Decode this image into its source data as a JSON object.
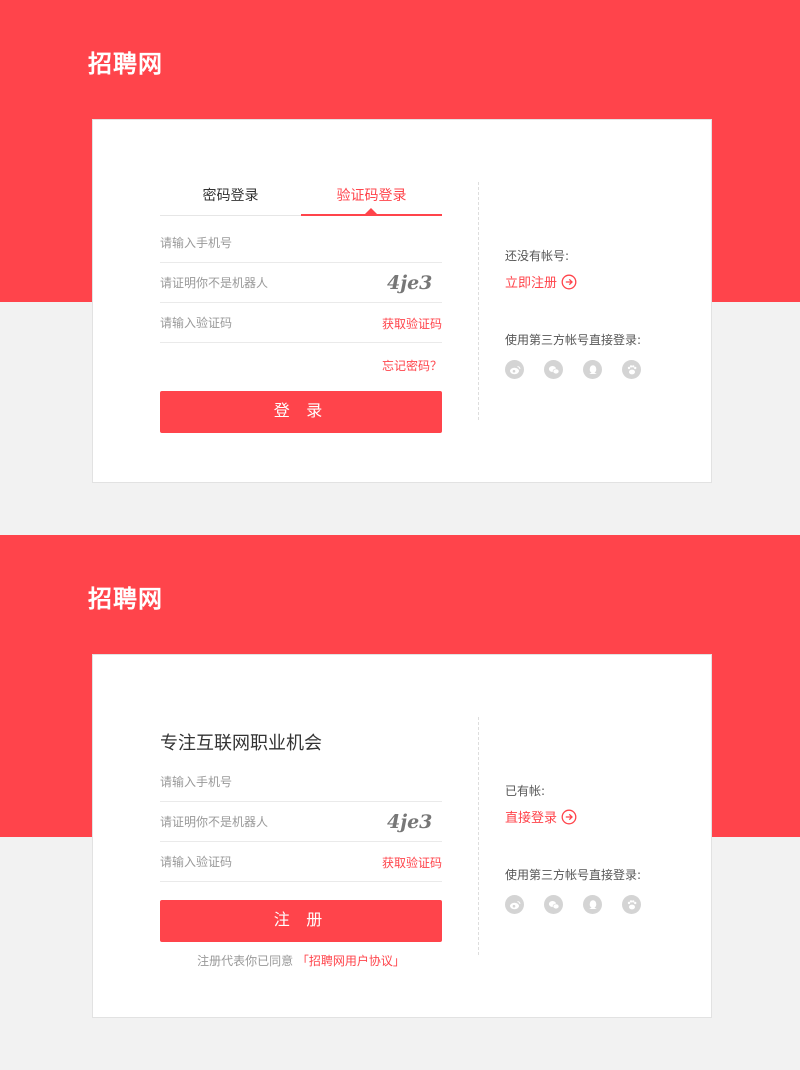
{
  "login": {
    "logo": "招聘网",
    "tabs": [
      {
        "label": "密码登录",
        "active": false
      },
      {
        "label": "验证码登录",
        "active": true
      }
    ],
    "phone_placeholder": "请输入手机号",
    "captcha_placeholder": "请证明你不是机器人",
    "captcha_text": "4je3",
    "sms_placeholder": "请输入验证码",
    "get_code": "获取验证码",
    "forgot": "忘记密码？",
    "submit": "登 录",
    "right": {
      "prompt": "还没有帐号:",
      "link": "立即注册",
      "third_party": "使用第三方帐号直接登录:"
    }
  },
  "register": {
    "logo": "招聘网",
    "heading": "专注互联网职业机会",
    "phone_placeholder": "请输入手机号",
    "captcha_placeholder": "请证明你不是机器人",
    "captcha_text": "4je3",
    "sms_placeholder": "请输入验证码",
    "get_code": "获取验证码",
    "submit": "注 册",
    "agreement_prefix": "注册代表你已同意",
    "agreement_link": "「招聘网用户协议」",
    "right": {
      "prompt": "已有帐:",
      "link": "直接登录",
      "third_party": "使用第三方帐号直接登录:"
    }
  },
  "icons": {
    "social": [
      "weibo-icon",
      "wechat-icon",
      "qq-icon",
      "baidu-icon"
    ],
    "arrow": "circle-arrow-right-icon"
  },
  "colors": {
    "brand": "#ff444b",
    "background": "#f2f2f2",
    "icon_gray": "#d4d4d4"
  }
}
